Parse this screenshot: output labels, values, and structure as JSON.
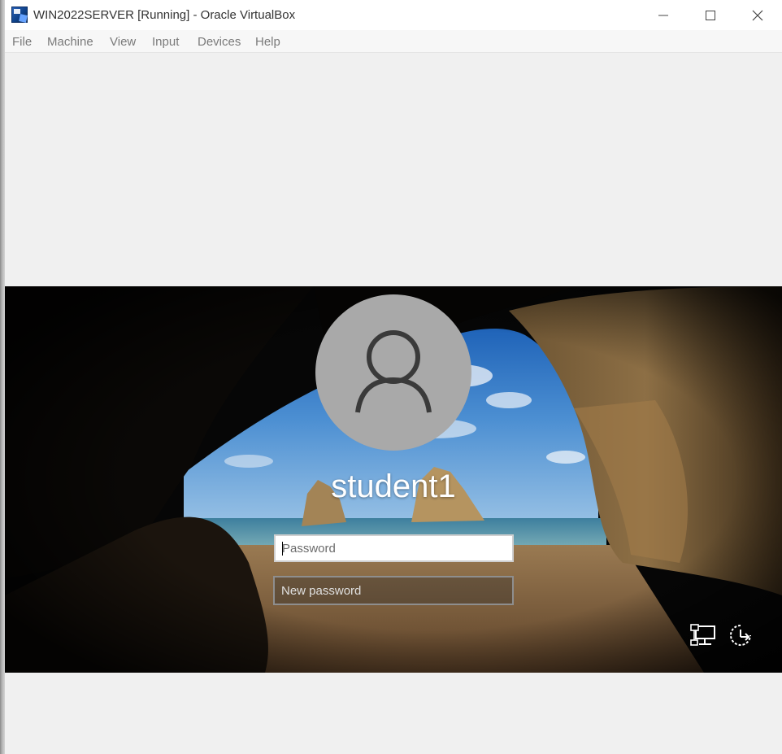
{
  "window": {
    "title": "WIN2022SERVER [Running] - Oracle VirtualBox",
    "app_icon": "virtualbox-vm-icon",
    "controls": [
      "minimize-icon",
      "maximize-icon",
      "close-icon"
    ]
  },
  "menubar": {
    "items": [
      {
        "label": "File"
      },
      {
        "label": "Machine"
      },
      {
        "label": "View"
      },
      {
        "label": "Input"
      },
      {
        "label": "Devices"
      },
      {
        "label": "Help"
      }
    ]
  },
  "login": {
    "username": "student1",
    "avatar_icon": "user-icon",
    "password_placeholder": "Password",
    "new_password_placeholder": "New password",
    "tray_icons": [
      "network-icon",
      "ease-of-access-power-icon"
    ]
  },
  "colors": {
    "titlebar": "#ffffff",
    "menubar": "#f7f7f7",
    "avatar": "#a9a9a9",
    "screen_background": "#050505"
  }
}
